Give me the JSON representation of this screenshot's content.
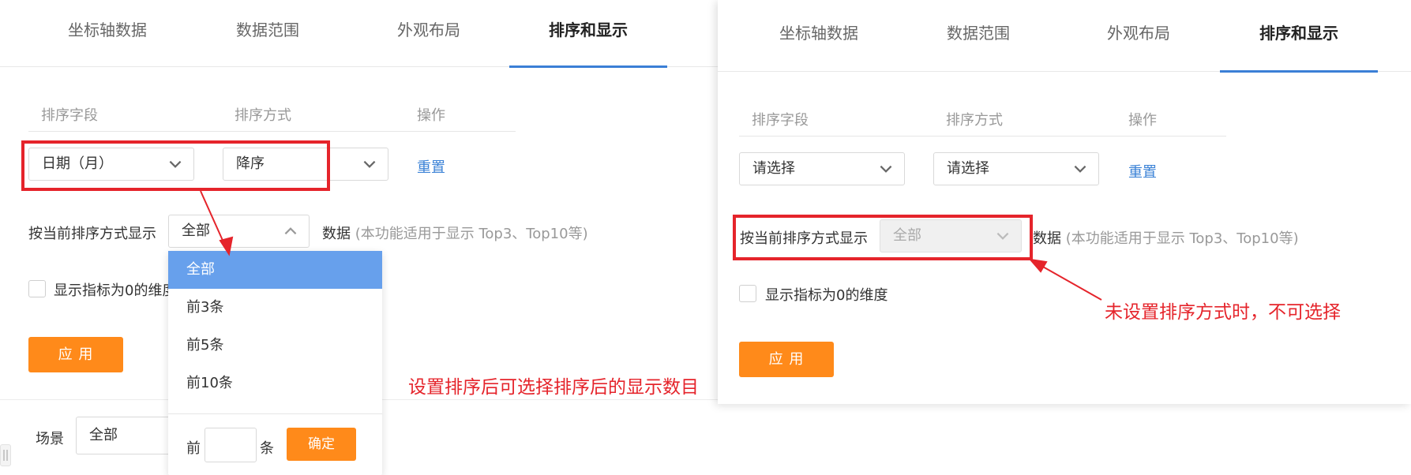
{
  "tabs": [
    "坐标轴数据",
    "数据范围",
    "外观布局",
    "排序和显示"
  ],
  "table_headers": [
    "排序字段",
    "排序方式",
    "操作"
  ],
  "left": {
    "sort_field": "日期（月）",
    "sort_order": "降序",
    "reset": "重置",
    "display_label": "按当前排序方式显示",
    "display_value": "全部",
    "data_word": "数据",
    "data_hint": "(本功能适用于显示 Top3、Top10等)",
    "zero_dim_label": "显示指标为0的维度",
    "apply": "应 用",
    "scene_label": "场景",
    "scene_value": "全部",
    "dropdown": {
      "options": [
        "全部",
        "前3条",
        "前5条",
        "前10条"
      ],
      "selected": "全部",
      "custom_prefix": "前",
      "custom_suffix": "条",
      "confirm": "确定"
    }
  },
  "right": {
    "sort_field": "请选择",
    "sort_order": "请选择",
    "reset": "重置",
    "display_label": "按当前排序方式显示",
    "display_value": "全部",
    "data_word": "数据",
    "data_hint": "(本功能适用于显示 Top3、Top10等)",
    "zero_dim_label": "显示指标为0的维度",
    "apply": "应 用"
  },
  "annotations": {
    "left_note": "设置排序后可选择排序后的显示数目",
    "right_note": "未设置排序方式时，不可选择",
    "color": "#e5242b"
  },
  "colors": {
    "accent_blue": "#3b7fd6",
    "link_blue": "#3b82d6",
    "orange": "#ff8a1a",
    "dropdown_selected": "#67a0ec"
  }
}
